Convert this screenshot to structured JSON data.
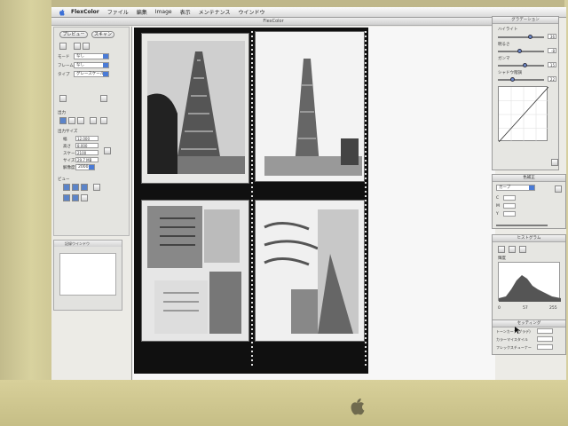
{
  "menubar": {
    "app_name": "FlexColor",
    "items": [
      "ファイル",
      "編集",
      "Image",
      "表示",
      "メンテナンス",
      "ウインドウ"
    ]
  },
  "window": {
    "title": "FlexColor"
  },
  "left_panel": {
    "preview_button": "プレビュー",
    "scan_button": "スキャン",
    "mode_select": "なし",
    "frame_select": "なし",
    "type_select": "グレースケール",
    "section_size": "出力サイズ",
    "size_fields": [
      "12.000",
      "8.000",
      "2100",
      "29.7 MB",
      "2000"
    ],
    "section_view": "ビュー",
    "mini_panel_title": "記録ウインドウ"
  },
  "right_panels": {
    "adjust_title": "グラデーション",
    "adjust_labels": [
      "ハイライト",
      "明るさ",
      "ガンマ",
      "シャドウ階調"
    ],
    "adjust_values": [
      "36",
      "-8",
      "15",
      "22"
    ],
    "curve_select": "カーブ",
    "colorcorr_title": "色補正",
    "color_labels": [
      "C",
      "M",
      "Y"
    ],
    "histogram_title": "ヒストグラム",
    "histogram_label": "輝度",
    "histogram_values": [
      "0",
      "57",
      "255"
    ],
    "settings_title": "セッティング",
    "settings_rows": [
      "トーンカーブ(グラデ)",
      "カラーマイスタイル",
      "フレックスチューナー"
    ]
  },
  "colors": {
    "bezel": "#d8d29f",
    "accent": "#4a7bd6",
    "film": "#101010"
  }
}
